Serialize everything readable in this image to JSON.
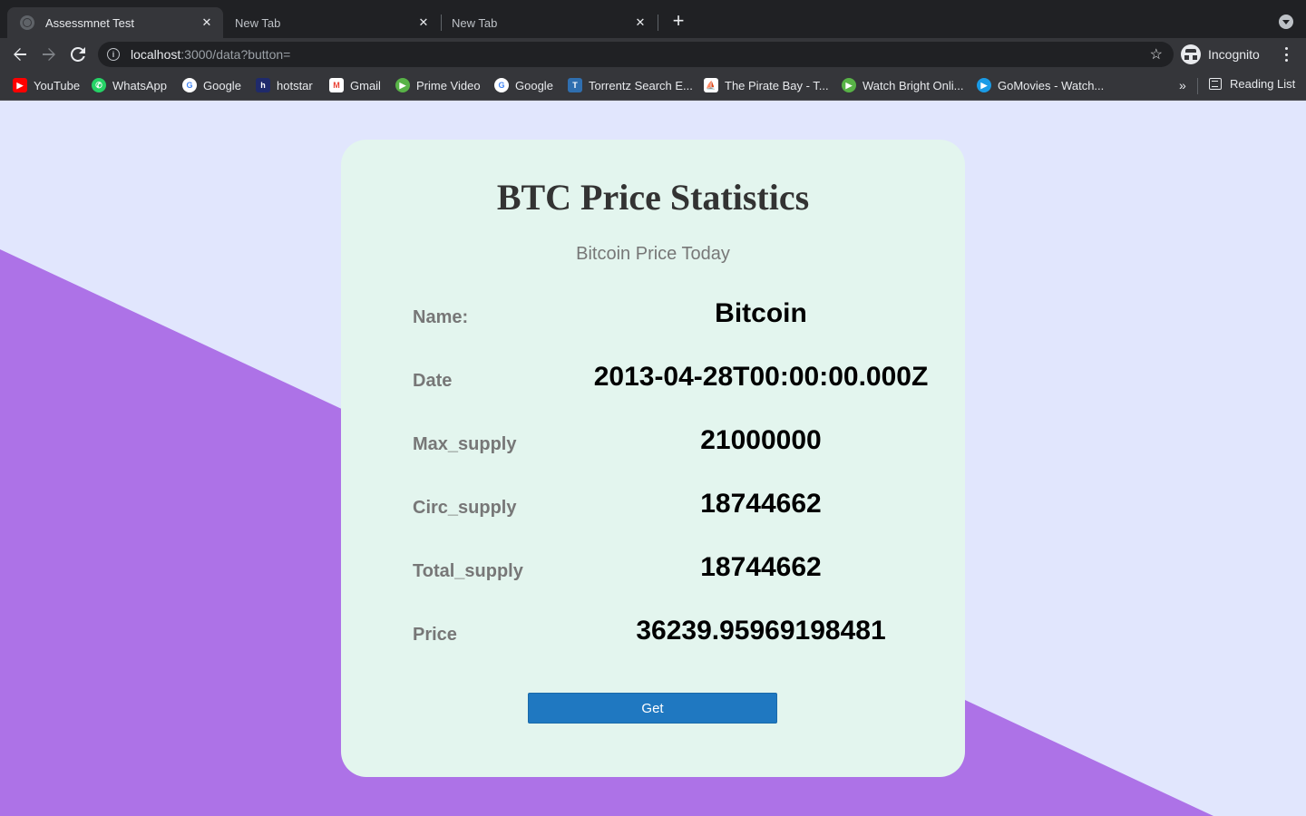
{
  "browser": {
    "tabs": [
      {
        "title": "Assessmnet Test",
        "active": true
      },
      {
        "title": "New Tab",
        "active": false
      },
      {
        "title": "New Tab",
        "active": false
      }
    ],
    "url": {
      "host": "localhost",
      "path": ":3000/data?button="
    },
    "profile_label": "Incognito",
    "bookmarks": [
      {
        "label": "YouTube",
        "icon": "youtube-icon",
        "color": "#ff0000"
      },
      {
        "label": "WhatsApp",
        "icon": "whatsapp-icon",
        "color": "#25d366"
      },
      {
        "label": "Google",
        "icon": "google-icon",
        "color": "#ffffff"
      },
      {
        "label": "hotstar",
        "icon": "hotstar-icon",
        "color": "#1f2a6b"
      },
      {
        "label": "Gmail",
        "icon": "gmail-icon",
        "color": "#ea4335"
      },
      {
        "label": "Prime Video",
        "icon": "prime-video-icon",
        "color": "#58b347"
      },
      {
        "label": "Google",
        "icon": "google-icon",
        "color": "#ffffff"
      },
      {
        "label": "Torrentz Search E...",
        "icon": "torrentz-icon",
        "color": "#2f6fb0"
      },
      {
        "label": "The Pirate Bay - T...",
        "icon": "pirate-bay-icon",
        "color": "#ffffff"
      },
      {
        "label": "Watch Bright Onli...",
        "icon": "watch-icon",
        "color": "#58b347"
      },
      {
        "label": "GoMovies - Watch...",
        "icon": "gomovies-icon",
        "color": "#1a9be6"
      }
    ],
    "reading_list_label": "Reading List"
  },
  "page": {
    "colors": {
      "background": "#e1e6fd",
      "shape": "#ad72e7",
      "card": "#e3f5ee",
      "button": "#1f78c1"
    },
    "title": "BTC Price Statistics",
    "subtitle": "Bitcoin Price Today",
    "stats": [
      {
        "label": "Name:",
        "value": "Bitcoin"
      },
      {
        "label": "Date",
        "value": "2013-04-28T00:00:00.000Z"
      },
      {
        "label": "Max_supply",
        "value": "21000000"
      },
      {
        "label": "Circ_supply",
        "value": "18744662"
      },
      {
        "label": "Total_supply",
        "value": "18744662"
      },
      {
        "label": "Price",
        "value": "36239.95969198481"
      }
    ],
    "button_label": "Get"
  }
}
